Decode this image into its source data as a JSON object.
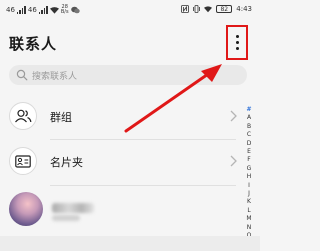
{
  "status_bar": {
    "left_signal_labels": [
      "46",
      "46"
    ],
    "rate_top": "28",
    "rate_bottom": "B/s",
    "battery": "82",
    "time": "4:43"
  },
  "header": {
    "title": "联系人"
  },
  "search": {
    "placeholder": "搜索联系人"
  },
  "rows": [
    {
      "label": "群组",
      "icon": "group-icon"
    },
    {
      "label": "名片夹",
      "icon": "business-card-icon"
    }
  ],
  "index_letters": [
    "#",
    "A",
    "B",
    "C",
    "D",
    "E",
    "F",
    "G",
    "H",
    "I",
    "J",
    "K",
    "L",
    "M",
    "N",
    "O"
  ],
  "colors": {
    "accent": "#2f72d9",
    "highlight": "#e01818"
  }
}
